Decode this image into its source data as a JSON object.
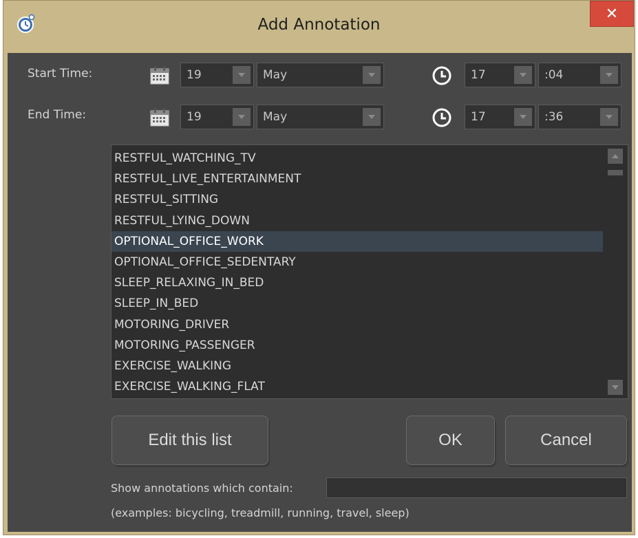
{
  "window": {
    "title": "Add Annotation",
    "close_symbol": "✕",
    "app_icon": "stopwatch-icon",
    "colors": {
      "frame": "#c9b98a",
      "client": "#474747",
      "close": "#d64a3c",
      "selection": "#3a4550"
    }
  },
  "start_time": {
    "label": "Start Time:",
    "day": "19",
    "month": "May",
    "hour": "17",
    "minute": ":04"
  },
  "end_time": {
    "label": "End Time:",
    "day": "19",
    "month": "May",
    "hour": "17",
    "minute": ":36"
  },
  "icons": {
    "date": "calendar-icon",
    "time": "clock-icon"
  },
  "annotation_list": {
    "items": [
      "RESTFUL_WATCHING_TV",
      "RESTFUL_LIVE_ENTERTAINMENT",
      "RESTFUL_SITTING",
      "RESTFUL_LYING_DOWN",
      "OPTIONAL_OFFICE_WORK",
      "OPTIONAL_OFFICE_SEDENTARY",
      "SLEEP_RELAXING_IN_BED",
      "SLEEP_IN_BED",
      "MOTORING_DRIVER",
      "MOTORING_PASSENGER",
      "EXERCISE_WALKING",
      "EXERCISE_WALKING_FLAT"
    ],
    "selected": "OPTIONAL_OFFICE_WORK"
  },
  "buttons": {
    "edit": "Edit this list",
    "ok": "OK",
    "cancel": "Cancel"
  },
  "filter": {
    "label": "Show annotations which contain:",
    "value": "",
    "hint": "(examples: bicycling, treadmill, running, travel, sleep)"
  }
}
